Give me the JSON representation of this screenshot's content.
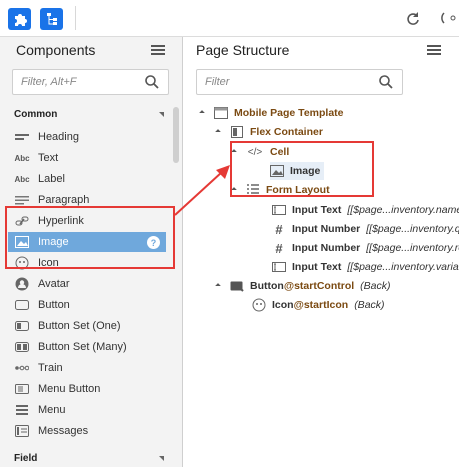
{
  "toolbar": {
    "icons": [
      "puzzle-icon",
      "tree-structure-icon",
      "refresh-icon",
      "cut-icon"
    ]
  },
  "components_panel": {
    "title": "Components",
    "search_placeholder": "Filter, Alt+F",
    "section_common": "Common",
    "section_field": "Field",
    "items": [
      {
        "label": "Heading",
        "icon": "heading-icon"
      },
      {
        "label": "Text",
        "icon": "text-icon"
      },
      {
        "label": "Label",
        "icon": "label-icon"
      },
      {
        "label": "Paragraph",
        "icon": "paragraph-icon"
      },
      {
        "label": "Hyperlink",
        "icon": "link-icon"
      },
      {
        "label": "Image",
        "icon": "image-icon",
        "selected": true
      },
      {
        "label": "Icon",
        "icon": "icon-icon"
      },
      {
        "label": "Avatar",
        "icon": "avatar-icon"
      },
      {
        "label": "Button",
        "icon": "button-icon"
      },
      {
        "label": "Button Set (One)",
        "icon": "button-set-one-icon"
      },
      {
        "label": "Button Set (Many)",
        "icon": "button-set-many-icon"
      },
      {
        "label": "Train",
        "icon": "train-icon"
      },
      {
        "label": "Menu Button",
        "icon": "menu-button-icon"
      },
      {
        "label": "Menu",
        "icon": "menu-icon"
      },
      {
        "label": "Messages",
        "icon": "messages-icon"
      }
    ],
    "help": "?"
  },
  "structure_panel": {
    "title": "Page Structure",
    "search_placeholder": "Filter",
    "nodes": {
      "mobile_page_template": "Mobile Page Template",
      "flex_container": "Flex Container",
      "cell": "Cell",
      "image": "Image",
      "form_layout": "Form Layout",
      "input_text_1": "Input Text",
      "input_text_1_binding": "[[$page...inventory.name",
      "input_number_1": "Input Number",
      "input_number_1_binding": "[[$page...inventory.qu",
      "input_number_2": "Input Number",
      "input_number_2_binding": "[[$page...inventory.re",
      "input_text_2": "Input Text",
      "input_text_2_binding": "[[$page...inventory.variar",
      "button": "Button",
      "button_slot": "@startControl",
      "button_binding": "(Back)",
      "icon": "Icon",
      "icon_slot": "@startIcon",
      "icon_binding": "(Back)"
    }
  },
  "colors": {
    "accent_blue": "#1a73e8",
    "selected_row": "#6fa8dc",
    "annotation_red": "#e53935",
    "node_brown": "#7b4a12"
  }
}
